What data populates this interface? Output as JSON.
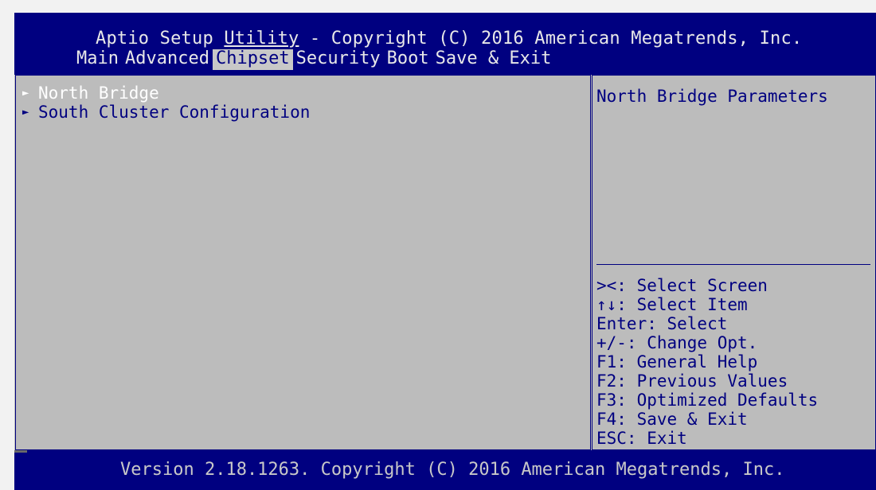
{
  "header": {
    "title_prefix": "Aptio Setup ",
    "title_underlined": "Utility",
    "title_suffix": " - Copyright (C) 2016 American Megatrends, Inc."
  },
  "menu": {
    "items": [
      {
        "label": "Main"
      },
      {
        "label": "Advanced"
      },
      {
        "label": "Chipset"
      },
      {
        "label": "Security"
      },
      {
        "label": "Boot"
      },
      {
        "label": "Save & Exit"
      }
    ],
    "active": "Chipset"
  },
  "main": {
    "items": [
      {
        "label": "North Bridge",
        "selected": true
      },
      {
        "label": "South Cluster Configuration",
        "selected": false
      }
    ]
  },
  "help": {
    "description": "North Bridge Parameters",
    "keys": [
      "><: Select Screen",
      "↑↓: Select Item",
      "Enter: Select",
      "+/-: Change Opt.",
      "F1: General Help",
      "F2: Previous Values",
      "F3: Optimized Defaults",
      "F4: Save & Exit",
      "ESC: Exit"
    ]
  },
  "footer": {
    "version": "Version 2.18.1263. Copyright (C) 2016 American Megatrends, Inc."
  },
  "colors": {
    "background": "#000080",
    "panel": "#bcbcbc",
    "text": "#000080",
    "highlight_text": "#ffffff"
  }
}
